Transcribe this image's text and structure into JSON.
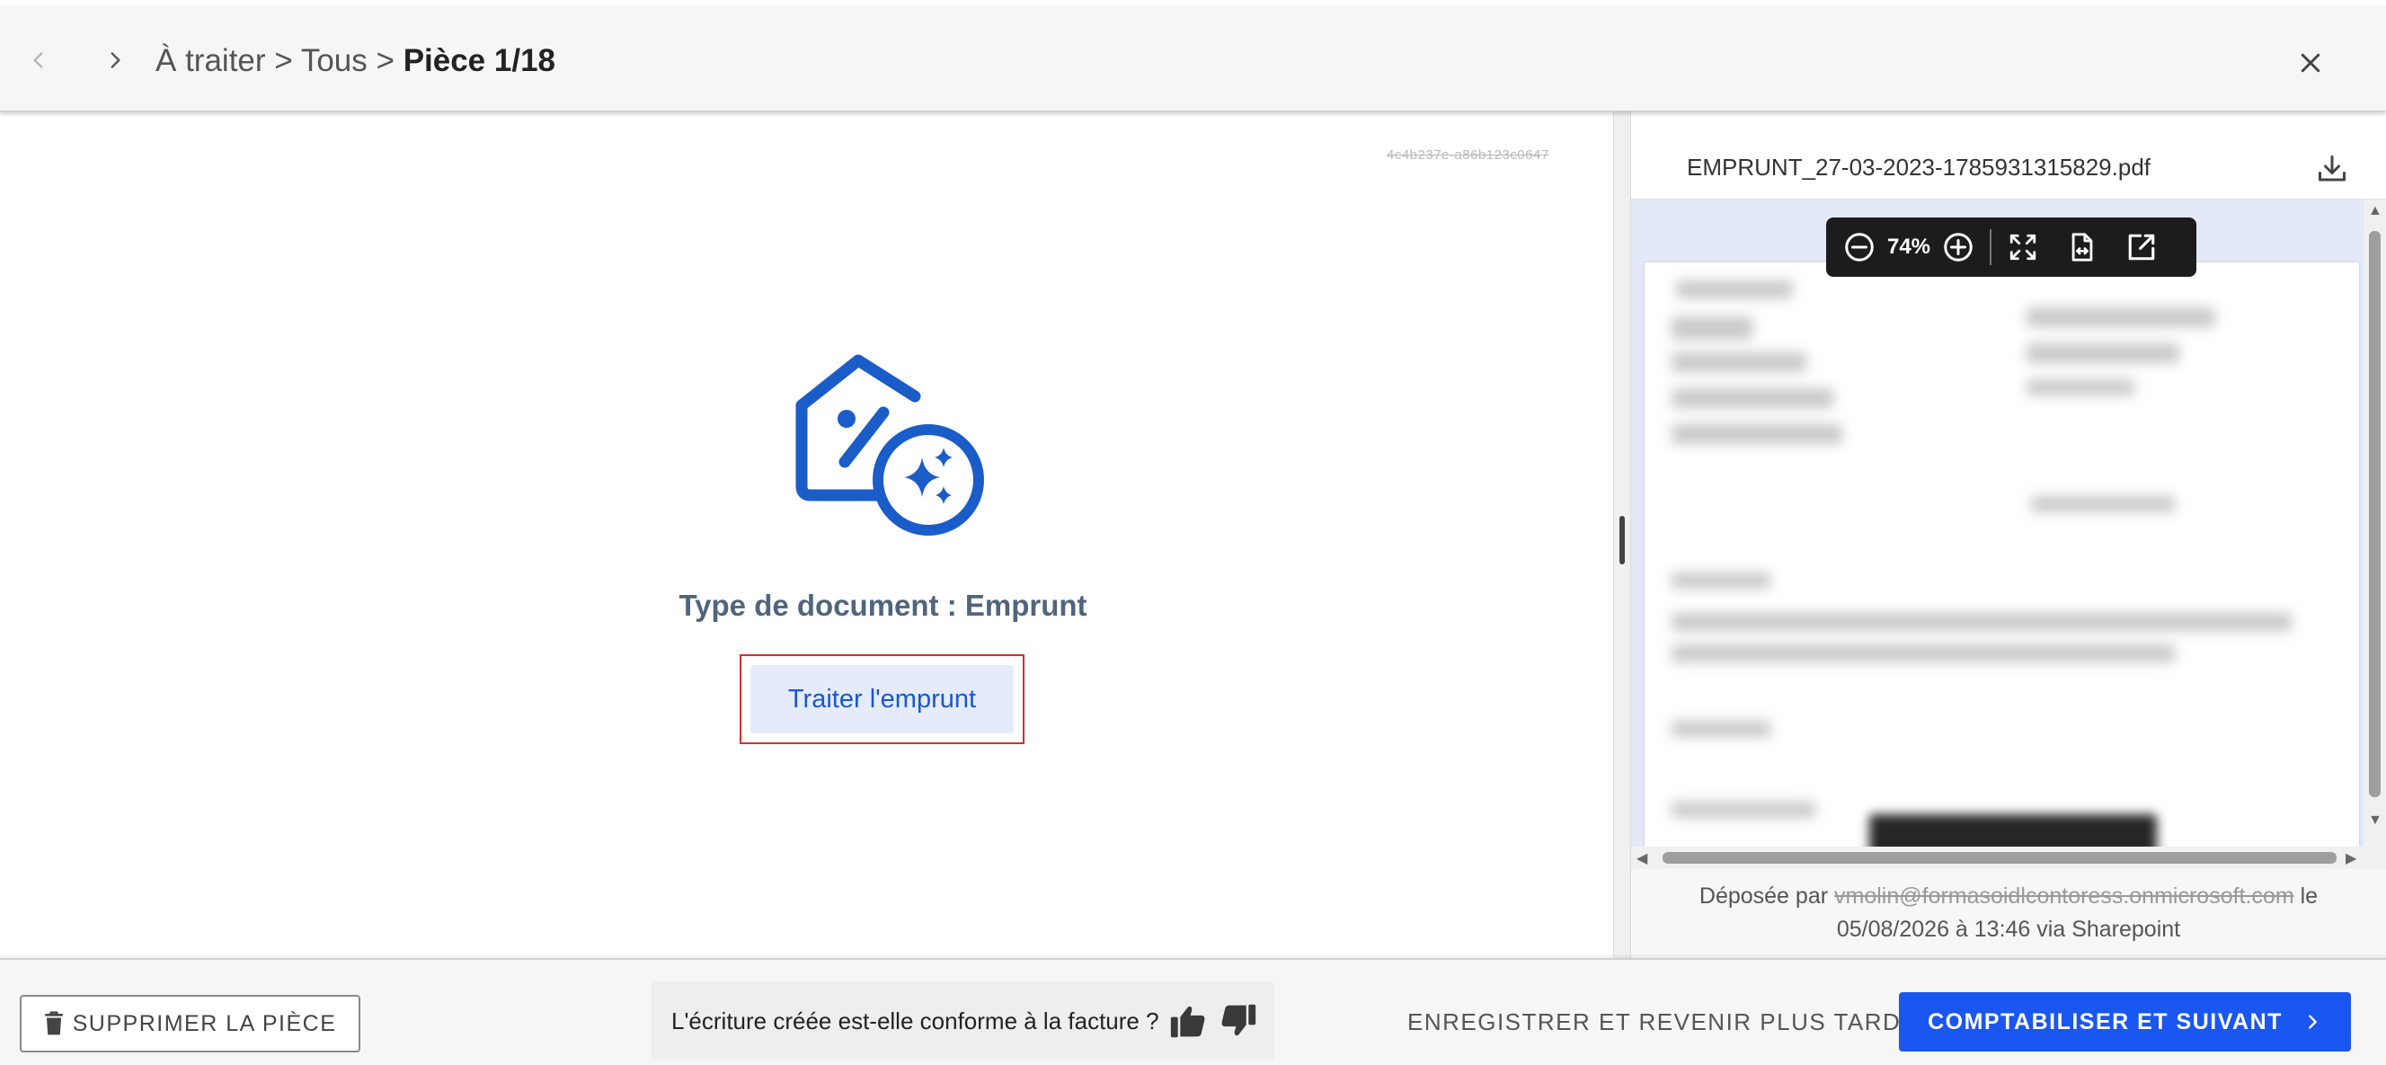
{
  "header": {
    "breadcrumb": {
      "level1": "À traiter",
      "separator1": ">",
      "level2": "Tous",
      "separator2": ">",
      "current": "Pièce 1/18"
    }
  },
  "document": {
    "id": "4c4b237e-a86b123c0647",
    "type_label": "Type de document : Emprunt",
    "process_button": "Traiter l'emprunt"
  },
  "viewer": {
    "filename": "EMPRUNT_27-03-2023-1785931315829.pdf",
    "zoom": "74%",
    "deposit_prefix": "Déposée par",
    "deposit_email": "vmolin@formasoidlcontoress.onmicrosoft.com",
    "deposit_suffix": "le",
    "deposit_date_line": "05/08/2026 à 13:46 via Sharepoint"
  },
  "footer": {
    "delete_label": "SUPPRIMER LA PIÈCE",
    "feedback_question": "L'écriture créée est-elle conforme à la facture ?",
    "save_later_label": "ENREGISTRER ET REVENIR PLUS TARD",
    "primary_label": "COMPTABILISER ET SUIVANT"
  },
  "colors": {
    "accent": "#1a56f0",
    "icon_blue": "#1a5cc8",
    "highlight": "#d32f2f",
    "doc_type_text": "#50657d"
  },
  "icons": {
    "prev": "chevron-left-icon",
    "next": "chevron-right-icon",
    "close": "close-icon",
    "hero": "tag-percent-sparkle-icon",
    "download": "download-icon",
    "zoom_out": "zoom-out-icon",
    "zoom_in": "zoom-in-icon",
    "fullscreen": "fullscreen-icon",
    "fit_page": "fit-page-icon",
    "open_external": "open-external-icon",
    "delete": "trash-icon",
    "thumbs_up": "thumbs-up-icon",
    "thumbs_down": "thumbs-down-icon",
    "primary_chevron": "chevron-right-icon"
  }
}
